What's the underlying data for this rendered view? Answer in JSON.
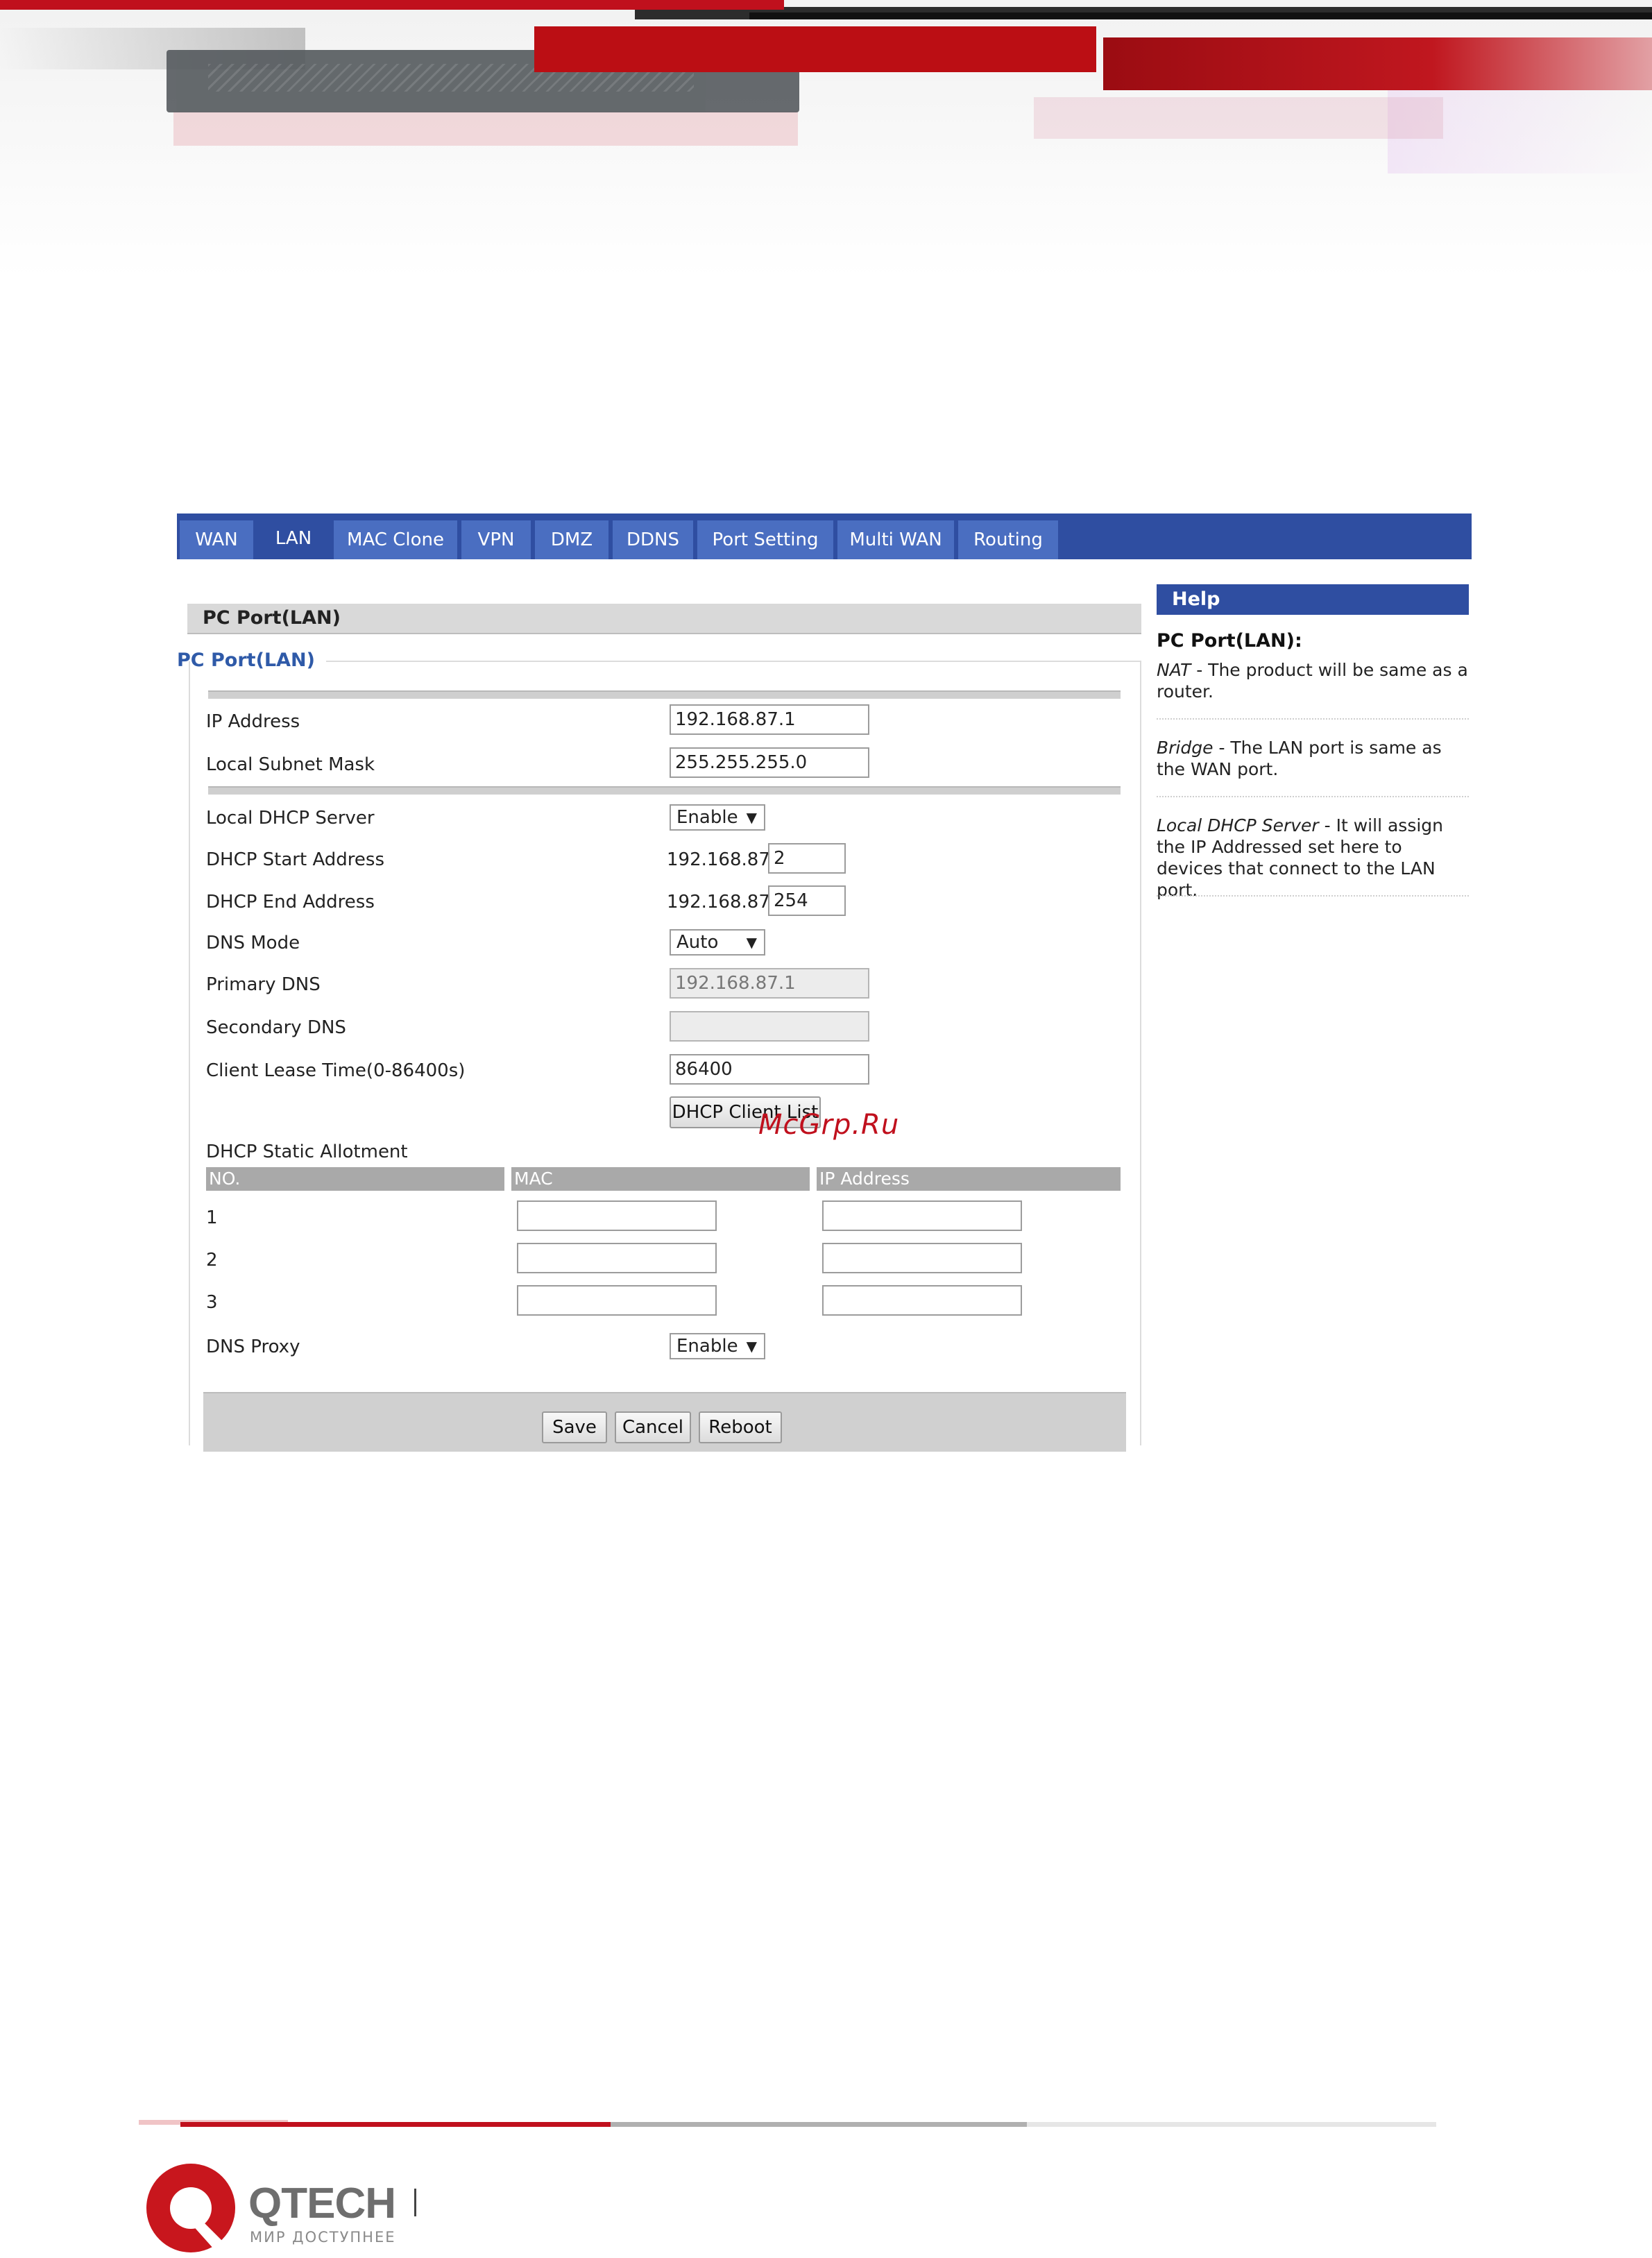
{
  "tabs": [
    "WAN",
    "LAN",
    "MAC Clone",
    "VPN",
    "DMZ",
    "DDNS",
    "Port Setting",
    "Multi WAN",
    "Routing"
  ],
  "active_tab": "LAN",
  "section_title": "PC Port(LAN)",
  "fieldset_legend": "PC Port(LAN)",
  "fields": {
    "ip_address": {
      "label": "IP Address",
      "value": "192.168.87.1"
    },
    "subnet_mask": {
      "label": "Local Subnet Mask",
      "value": "255.255.255.0"
    },
    "dhcp_server": {
      "label": "Local DHCP Server",
      "value": "Enable"
    },
    "dhcp_start": {
      "label": "DHCP Start Address",
      "prefix": "192.168.87.",
      "value": "2"
    },
    "dhcp_end": {
      "label": "DHCP End Address",
      "prefix": "192.168.87.",
      "value": "254"
    },
    "dns_mode": {
      "label": "DNS Mode",
      "value": "Auto"
    },
    "primary_dns": {
      "label": "Primary DNS",
      "value": "192.168.87.1"
    },
    "secondary_dns": {
      "label": "Secondary DNS",
      "value": ""
    },
    "lease_time": {
      "label": "Client Lease Time(0-86400s)",
      "value": "86400"
    },
    "dns_proxy": {
      "label": "DNS Proxy",
      "value": "Enable"
    }
  },
  "dhcp_client_list_button": "DHCP Client List",
  "static_allotment": {
    "title": "DHCP Static Allotment",
    "columns": [
      "NO.",
      "MAC",
      "IP Address"
    ],
    "rows": [
      {
        "no": "1",
        "mac": "",
        "ip": ""
      },
      {
        "no": "2",
        "mac": "",
        "ip": ""
      },
      {
        "no": "3",
        "mac": "",
        "ip": ""
      }
    ]
  },
  "buttons": {
    "save": "Save",
    "cancel": "Cancel",
    "reboot": "Reboot"
  },
  "help": {
    "header": "Help",
    "title": "PC Port(LAN):",
    "items": [
      {
        "term": "NAT",
        "text": " - The product will be same as a router."
      },
      {
        "term": "Bridge",
        "text": " - The LAN port is same as the WAN port."
      },
      {
        "term": "Local DHCP Server",
        "text": " - It will assign the IP Addressed set here to devices that connect to the LAN port."
      }
    ]
  },
  "watermark": "McGrp.Ru",
  "footer": {
    "brand": "QTECH",
    "tagline": "МИР ДОСТУПНЕЕ"
  },
  "colors": {
    "tab_bar": "#2f4ea1",
    "tab": "#4a6ec1",
    "brand_red": "#c0101d",
    "legend": "#2f5aa8"
  }
}
